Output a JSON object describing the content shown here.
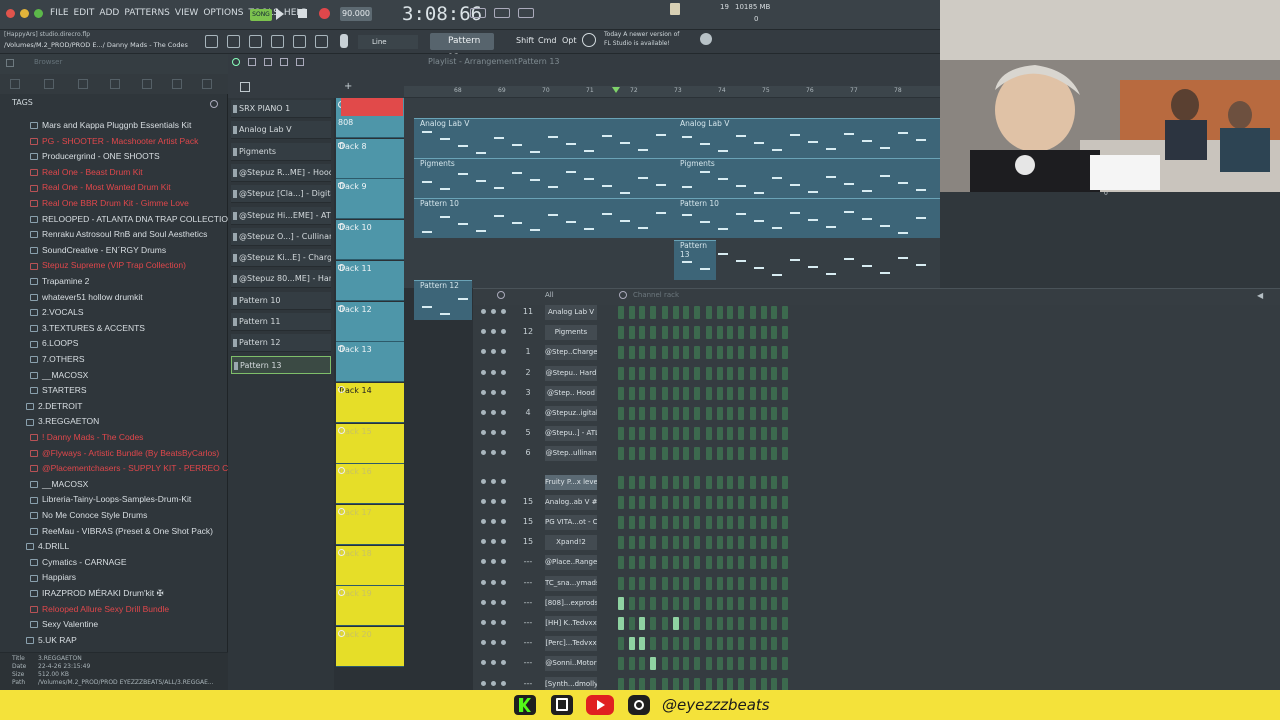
{
  "menu": [
    "FILE",
    "EDIT",
    "ADD",
    "PATTERNS",
    "VIEW",
    "OPTIONS",
    "TOOLS",
    "HELP"
  ],
  "transport": {
    "mode": "SONG",
    "tempo": "90.000",
    "time": "3:08:66"
  },
  "cpu": {
    "value": "19",
    "memory": "10185 MB",
    "bottom": "0"
  },
  "project": {
    "path1": "[HappyArs] studio.direcro.flp",
    "path2": "/Volumes/M.2_PROD/PROD E.../ Danny Mads - The Codes"
  },
  "toolbar": {
    "line": "Line",
    "pattern": "Pattern 13",
    "shift": "Shift",
    "cmd": "Cmd",
    "opt": "Opt"
  },
  "hint": {
    "line1": "Today  A newer version of",
    "line2": "FL Studio is available!"
  },
  "playlist_header": {
    "title": "Playlist - Arrangement",
    "pattern": "Pattern 13"
  },
  "browser": {
    "title": "Browser",
    "tags": "TAGS",
    "items": [
      {
        "label": "Mars and Kappa Pluggnb Essentials Kit",
        "color": "white",
        "indent": 1
      },
      {
        "label": "PG - SHOOTER - Macshooter Artist Pack",
        "color": "red",
        "indent": 1
      },
      {
        "label": "Producergrind - ONE SHOOTS",
        "color": "white",
        "indent": 1
      },
      {
        "label": "Real One - Beast Drum Kit",
        "color": "red",
        "indent": 1
      },
      {
        "label": "Real One - Most Wanted Drum Kit",
        "color": "red",
        "indent": 1
      },
      {
        "label": "Real One BBR Drum Kit - Gimme Love",
        "color": "red",
        "indent": 1
      },
      {
        "label": "RELOOPED - ATLANTA DNA TRAP COLLECTION",
        "color": "white",
        "indent": 1
      },
      {
        "label": "Renraku Astrosoul RnB and Soul Aesthetics",
        "color": "white",
        "indent": 1
      },
      {
        "label": "SoundCreative - EN´RGY Drums",
        "color": "white",
        "indent": 1
      },
      {
        "label": "Stepuz Supreme (VIP Trap Collection)",
        "color": "red",
        "indent": 1
      },
      {
        "label": "Trapamine 2",
        "color": "white",
        "indent": 1
      },
      {
        "label": "whatever51 hollow drumkit",
        "color": "white",
        "indent": 1
      },
      {
        "label": "2.VOCALS",
        "color": "white",
        "indent": 0
      },
      {
        "label": "3.TEXTURES & ACCENTS",
        "color": "white",
        "indent": 0
      },
      {
        "label": "6.LOOPS",
        "color": "white",
        "indent": 0
      },
      {
        "label": "7.OTHERS",
        "color": "white",
        "indent": 0
      },
      {
        "label": "__MACOSX",
        "color": "white",
        "indent": 0
      },
      {
        "label": "STARTERS",
        "color": "white",
        "indent": 0
      },
      {
        "label": "2.DETROIT",
        "color": "white",
        "indent": -1
      },
      {
        "label": "3.REGGAETON",
        "color": "white",
        "indent": -1
      },
      {
        "label": "! Danny Mads - The Codes",
        "color": "red",
        "indent": 0
      },
      {
        "label": "@Flyways - Artistic Bundle (By BeatsByCarlos)",
        "color": "red",
        "indent": 0
      },
      {
        "label": "@Placementchasers - SUPPLY KIT - PERREO CAMO",
        "color": "red",
        "indent": 0
      },
      {
        "label": "__MACOSX",
        "color": "white",
        "indent": 0
      },
      {
        "label": "Libreria-Tainy-Loops-Samples-Drum-Kit",
        "color": "white",
        "indent": 0
      },
      {
        "label": "No Me Conoce Style Drums",
        "color": "white",
        "indent": 0
      },
      {
        "label": "ReeMau - VIBRAS (Preset & One Shot Pack)",
        "color": "white",
        "indent": 0
      },
      {
        "label": "4.DRILL",
        "color": "white",
        "indent": -1
      },
      {
        "label": "Cymatics - CARNAGE",
        "color": "white",
        "indent": 0
      },
      {
        "label": "Happiars",
        "color": "white",
        "indent": 0
      },
      {
        "label": "IRAZPROD MÉRAKI Drum'kit ✠",
        "color": "white",
        "indent": 0
      },
      {
        "label": "Relooped Allure Sexy Drill Bundle",
        "color": "red",
        "indent": 0
      },
      {
        "label": "Sexy Valentine",
        "color": "white",
        "indent": 0
      },
      {
        "label": "5.UK RAP",
        "color": "white",
        "indent": -1
      }
    ],
    "info": {
      "title_label": "Title",
      "title_value": "3.REGGAETON",
      "date_label": "Date",
      "date_value": "22-4-26 23:15:49",
      "size_label": "Size",
      "size_value": "512.00 KB",
      "path_label": "Path",
      "path_value": "/Volumes/M.2_PROD/PROD EYEZZZBEATS/ALL/3.REGGAE..."
    }
  },
  "picker": [
    "SRX PIANO 1",
    "Analog Lab V",
    "Pigments",
    "@Stepuz R...ME] - Hood",
    "@Stepuz [Cla...] - Digital",
    "@Stepuz Hi...EME] - ATL",
    "@Stepuz O...] - Cullinan",
    "@Stepuz Ki...E] - Charge",
    "@Stepuz 80...ME] - Hard",
    "Pattern 10",
    "Pattern 11",
    "Pattern 12",
    "Pattern 13"
  ],
  "tracks": [
    {
      "label": "808",
      "color": "#4e96a9"
    },
    {
      "label": "Track 8",
      "color": "#4e96a9"
    },
    {
      "label": "Track 9",
      "color": "#4e96a9"
    },
    {
      "label": "Track 10",
      "color": "#4e96a9"
    },
    {
      "label": "Track 11",
      "color": "#4e96a9"
    },
    {
      "label": "Track 12",
      "color": "#4e96a9"
    },
    {
      "label": "Track 13",
      "color": "#4e96a9"
    },
    {
      "label": "Track 14",
      "color": "#e6de28"
    },
    {
      "label": "Track 15",
      "color": "#e6de28"
    },
    {
      "label": "Track 16",
      "color": "#e6de28"
    },
    {
      "label": "Track 17",
      "color": "#e6de28"
    },
    {
      "label": "Track 18",
      "color": "#e6de28"
    },
    {
      "label": "Track 19",
      "color": "#e6de28"
    },
    {
      "label": "Track 20",
      "color": "#e6de28"
    }
  ],
  "ruler": [
    "68",
    "69",
    "70",
    "71",
    "72",
    "73",
    "74",
    "75",
    "76",
    "77",
    "78"
  ],
  "clips": [
    {
      "label": "Analog Lab V",
      "row": 0
    },
    {
      "label": "Analog Lab V",
      "row": 0
    },
    {
      "label": "Pigments",
      "row": 1
    },
    {
      "label": "Pigments",
      "row": 1
    },
    {
      "label": "Pattern 10",
      "row": 2
    },
    {
      "label": "Pattern 10",
      "row": 2
    },
    {
      "label": "Pattern 13",
      "row": 3
    },
    {
      "label": "Pattern 12",
      "row": 4
    }
  ],
  "channel_rack": {
    "filter": "All",
    "title": "Channel rack",
    "channels": [
      {
        "num": "11",
        "name": "Analog Lab V"
      },
      {
        "num": "12",
        "name": "Pigments"
      },
      {
        "num": "1",
        "name": "@Step..Charge"
      },
      {
        "num": "2",
        "name": "@Stepu.. Hard"
      },
      {
        "num": "3",
        "name": "@Step.. Hood"
      },
      {
        "num": "4",
        "name": "@Stepuz..igital"
      },
      {
        "num": "5",
        "name": "@Stepu..] - ATL"
      },
      {
        "num": "6",
        "name": "@Step..ullinan"
      },
      {
        "num": "",
        "name": "Fruity P...x level"
      },
      {
        "num": "15",
        "name": "Analog..ab V #2"
      },
      {
        "num": "15",
        "name": "PG VITA...ot - C"
      },
      {
        "num": "15",
        "name": "Xpand!2"
      },
      {
        "num": "---",
        "name": "@Place..Range"
      },
      {
        "num": "---",
        "name": "TC_sna...ymads"
      },
      {
        "num": "---",
        "name": "[808]...exprods"
      },
      {
        "num": "---",
        "name": "[HH] K..Tedvxx"
      },
      {
        "num": "---",
        "name": "[Perc]...Tedvxx"
      },
      {
        "num": "---",
        "name": "@Sonni..Motor"
      },
      {
        "num": "---",
        "name": "[Synth...dmolly]"
      }
    ]
  },
  "social": {
    "handle": "@eyezzzbeats"
  },
  "colors": {
    "accent_green": "#8fd3a2",
    "track_blue": "#4e96a9",
    "track_yellow": "#e6de28",
    "selected_red": "#e0474b",
    "brand_bar": "#f4e23a"
  }
}
